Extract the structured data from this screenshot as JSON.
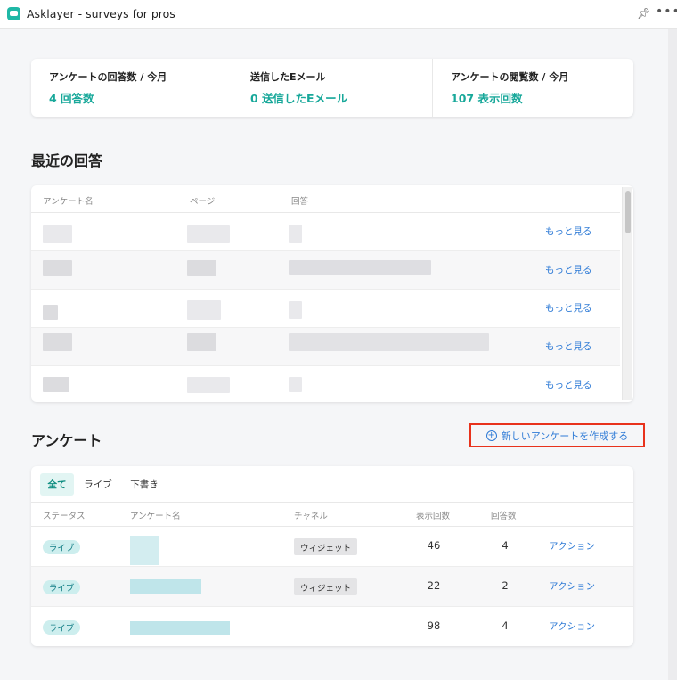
{
  "app": {
    "title": "Asklayer - surveys for pros",
    "logo_icon": "chat-bubble-icon",
    "accent": "#1fb8a6"
  },
  "window": {
    "pin_icon": "pin-icon",
    "more_icon": "more-icon",
    "more_glyph": "•••"
  },
  "stats": [
    {
      "label": "アンケートの回答数 / 今月",
      "value": "4 回答数"
    },
    {
      "label": "送信したEメール",
      "value": "0 送信したEメール"
    },
    {
      "label": "アンケートの閲覧数 / 今月",
      "value": "107 表示回数"
    }
  ],
  "recent": {
    "title": "最近の回答",
    "columns": {
      "survey": "アンケート名",
      "page": "ページ",
      "answer": "回答"
    },
    "rows": [
      {
        "link": "もっと見る"
      },
      {
        "link": "もっと見る"
      },
      {
        "link": "もっと見る"
      },
      {
        "link": "もっと見る"
      },
      {
        "link": "もっと見る"
      }
    ]
  },
  "surveys": {
    "title": "アンケート",
    "create_button": "新しいアンケートを作成する",
    "create_glyph": "+",
    "tabs": [
      {
        "label": "全て",
        "active": true
      },
      {
        "label": "ライブ"
      },
      {
        "label": "下書き"
      }
    ],
    "columns": {
      "status": "ステータス",
      "name": "アンケート名",
      "channel": "チャネル",
      "views": "表示回数",
      "answers": "回答数"
    },
    "rows": [
      {
        "status": "ライブ",
        "channel": "ウィジェット",
        "views": "46",
        "answers": "4",
        "action": "アクション"
      },
      {
        "status": "ライブ",
        "channel": "ウィジェット",
        "views": "22",
        "answers": "2",
        "action": "アクション"
      },
      {
        "status": "ライブ",
        "channel": "",
        "views": "98",
        "answers": "4",
        "action": "アクション"
      }
    ]
  },
  "colors": {
    "link": "#2f7bd6",
    "stat_value": "#18a89a",
    "badge_bg": "#cdeeee",
    "highlight_border": "#e8321c"
  }
}
